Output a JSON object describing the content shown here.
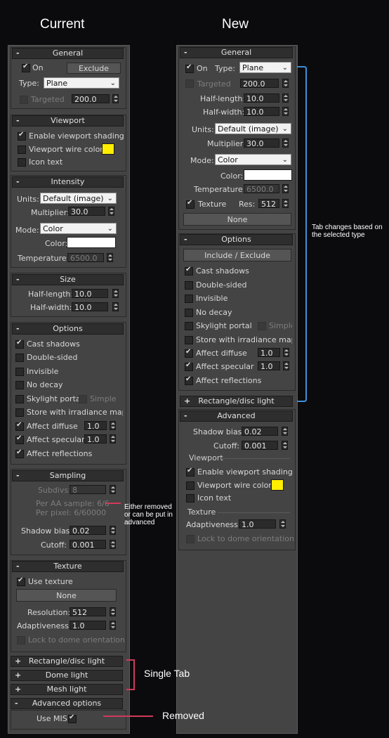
{
  "headers": {
    "current": "Current",
    "new": "New"
  },
  "colors": {
    "accent_red": "#d03a5b",
    "accent_blue": "#3d8fd9",
    "swatch_yellow": "#ffee00",
    "swatch_white": "#ffffff"
  },
  "current": {
    "general": {
      "title": "General",
      "on_label": "On",
      "exclude_label": "Exclude",
      "type_label": "Type:",
      "type_value": "Plane",
      "targeted_label": "Targeted",
      "targeted_value": "200.0"
    },
    "viewport": {
      "title": "Viewport",
      "enable_shading": "Enable viewport shading",
      "wire_color": "Viewport wire color",
      "icon_text": "Icon text"
    },
    "intensity": {
      "title": "Intensity",
      "units_label": "Units:",
      "units_value": "Default (image)",
      "multiplier_label": "Multiplier:",
      "multiplier_value": "30.0",
      "mode_label": "Mode:",
      "mode_value": "Color",
      "color_label": "Color:",
      "temperature_label": "Temperature:",
      "temperature_value": "6500.0"
    },
    "size": {
      "title": "Size",
      "half_length_label": "Half-length:",
      "half_length_value": "10.0",
      "half_width_label": "Half-width:",
      "half_width_value": "10.0"
    },
    "options": {
      "title": "Options",
      "cast_shadows": "Cast shadows",
      "double_sided": "Double-sided",
      "invisible": "Invisible",
      "no_decay": "No decay",
      "skylight_portal": "Skylight portal",
      "simple": "Simple",
      "store_irradiance": "Store with irradiance map",
      "affect_diffuse": "Affect diffuse",
      "affect_diffuse_value": "1.0",
      "affect_specular": "Affect specular",
      "affect_specular_value": "1.0",
      "affect_reflections": "Affect reflections"
    },
    "sampling": {
      "title": "Sampling",
      "subdivs_label": "Subdivs:",
      "subdivs_value": "8",
      "per_aa": "Per AA sample: 6/6",
      "per_pixel": "Per pixel: 6/60000",
      "shadow_bias_label": "Shadow bias:",
      "shadow_bias_value": "0.02",
      "cutoff_label": "Cutoff:",
      "cutoff_value": "0.001"
    },
    "texture": {
      "title": "Texture",
      "use_texture": "Use texture",
      "none_label": "None",
      "resolution_label": "Resolution:",
      "resolution_value": "512",
      "adaptiveness_label": "Adaptiveness:",
      "adaptiveness_value": "1.0",
      "lock_dome": "Lock to dome orientation"
    },
    "collapsed": {
      "rect_disc": "Rectangle/disc light",
      "dome": "Dome light",
      "mesh": "Mesh light",
      "advanced": "Advanced options",
      "use_mis": "Use MIS"
    }
  },
  "new": {
    "general": {
      "title": "General",
      "on_label": "On",
      "type_label": "Type:",
      "type_value": "Plane",
      "targeted_label": "Targeted",
      "targeted_value": "200.0",
      "half_length_label": "Half-length:",
      "half_length_value": "10.0",
      "half_width_label": "Half-width:",
      "half_width_value": "10.0",
      "units_label": "Units:",
      "units_value": "Default (image)",
      "multiplier_label": "Multiplier:",
      "multiplier_value": "30.0",
      "mode_label": "Mode:",
      "mode_value": "Color",
      "color_label": "Color:",
      "temperature_label": "Temperature:",
      "temperature_value": "6500.0",
      "texture_label": "Texture",
      "res_label": "Res:",
      "res_value": "512",
      "none_label": "None"
    },
    "options": {
      "title": "Options",
      "include_exclude": "Include / Exclude",
      "cast_shadows": "Cast shadows",
      "double_sided": "Double-sided",
      "invisible": "Invisible",
      "no_decay": "No decay",
      "skylight_portal": "Skylight portal",
      "simple": "Simple",
      "store_irradiance": "Store with irradiance map",
      "affect_diffuse": "Affect diffuse",
      "affect_diffuse_value": "1.0",
      "affect_specular": "Affect specular",
      "affect_specular_value": "1.0",
      "affect_reflections": "Affect reflections"
    },
    "rect_disc": "Rectangle/disc light",
    "advanced": {
      "title": "Advanced",
      "shadow_bias_label": "Shadow bias:",
      "shadow_bias_value": "0.02",
      "cutoff_label": "Cutoff:",
      "cutoff_value": "0.001",
      "viewport_sub": "Viewport",
      "enable_shading": "Enable viewport shading",
      "wire_color": "Viewport wire color",
      "icon_text": "Icon text",
      "texture_sub": "Texture",
      "adaptiveness_label": "Adaptiveness:",
      "adaptiveness_value": "1.0",
      "lock_dome": "Lock to dome orientation"
    }
  },
  "annotations": {
    "removed_or_advanced": "Either removed or can be put in advanced",
    "single_tab": "Single Tab",
    "removed": "Removed",
    "tab_changes": "Tab changes based on the selected type"
  }
}
